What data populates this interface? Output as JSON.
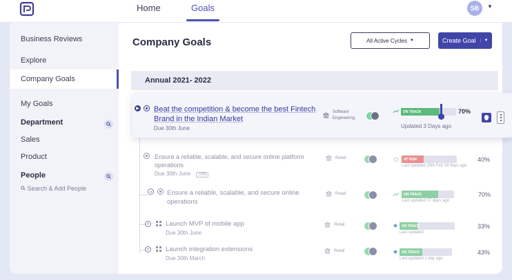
{
  "nav": {
    "home": "Home",
    "goals": "Goals"
  },
  "user": {
    "initials": "SB"
  },
  "sidebar": {
    "items": [
      "Business Reviews",
      "Explore",
      "Company Goals",
      "My Goals"
    ],
    "department_heading": "Department",
    "departments": [
      "Sales",
      "Product"
    ],
    "people_heading": "People",
    "people_search": "Search & Add People"
  },
  "main": {
    "title": "Company Goals",
    "cycles_button": "All Active Cycles",
    "create_button": "Create Goal",
    "section": "Annual 2021- 2022"
  },
  "goals": [
    {
      "title": "Beat the competition & become the best Fintech Brand in the Indian Market",
      "due": "Due 30th June",
      "team": "Software Engineering",
      "status": "ON TRACK",
      "progress": 70,
      "pct": "70%",
      "updated": "Updated 3 Days ago"
    },
    {
      "title": "Ensure a reliable, scalable, and secure online platform operations",
      "due": "Due 30th June",
      "tag": "70%",
      "team": "Retail",
      "status": "AT RISK",
      "progress": 40,
      "pct": "40%",
      "updated": "Last updated 25th Feb 19 days ago"
    },
    {
      "title": "Ensure a reliable, scalable, and secure online operations",
      "due": "",
      "team": "Retail",
      "status": "ON TRACK",
      "progress": 70,
      "pct": "70%",
      "updated": "Last updated 17 days ago"
    },
    {
      "title": "Launch MVP of mobile app",
      "due": "Due 30th June",
      "team": "Retail",
      "status": "ON TRACK",
      "progress": 33,
      "pct": "33%",
      "updated": "Last updated"
    },
    {
      "title": "Launch integration extensions",
      "due": "Due 30th March",
      "team": "Retail",
      "status": "ON TRACK",
      "progress": 43,
      "pct": "43%",
      "updated": "Last updated 1 day ago"
    }
  ],
  "colors": {
    "accent": "#4145a8",
    "on_track": "#5cba7d",
    "at_risk": "#e46a6a"
  }
}
